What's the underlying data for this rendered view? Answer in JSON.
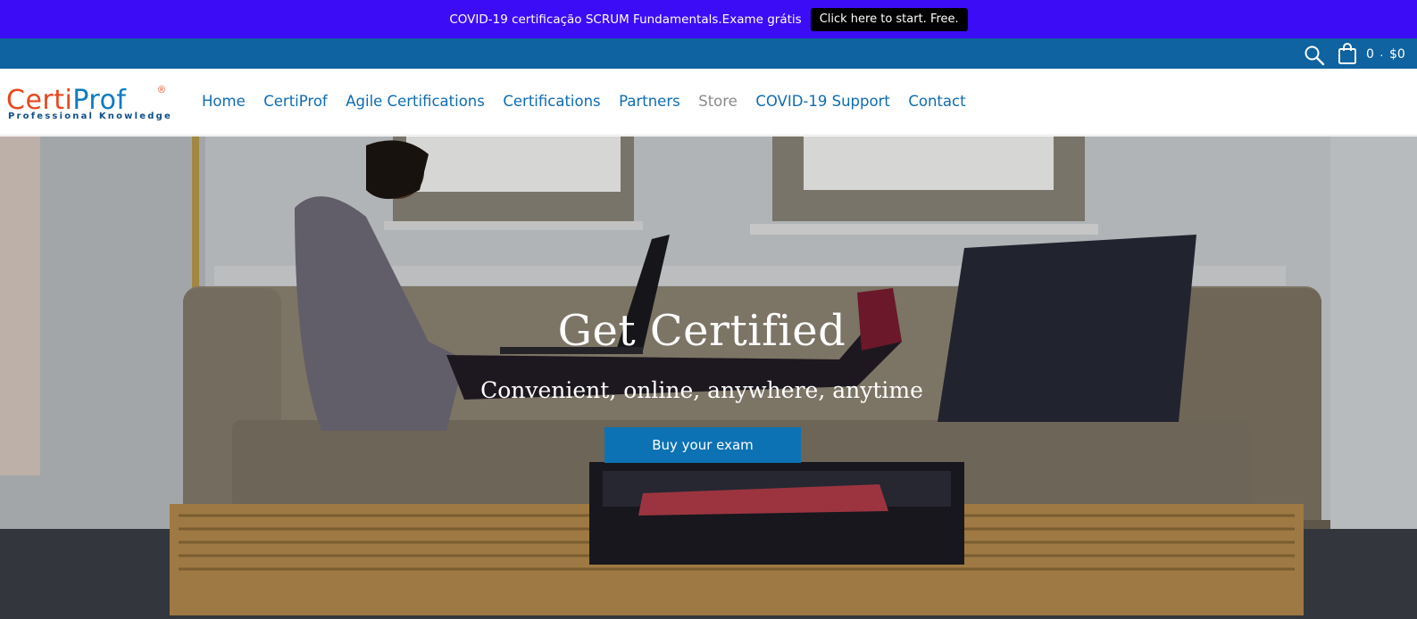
{
  "announcement": {
    "text": "COVID-19 certificação SCRUM Fundamentals.Exame grátis",
    "button_label": "Click here to start. Free."
  },
  "utility_bar": {
    "cart_count": "0",
    "cart_separator": "·",
    "cart_total": "$0"
  },
  "logo": {
    "part1": "Certi",
    "part2": "Prof",
    "registered": "®",
    "tagline": "Professional Knowledge"
  },
  "nav": {
    "items": [
      {
        "label": "Home"
      },
      {
        "label": "CertiProf"
      },
      {
        "label": "Agile Certifications"
      },
      {
        "label": "Certifications"
      },
      {
        "label": "Partners"
      },
      {
        "label": "Store"
      },
      {
        "label": "COVID-19 Support"
      },
      {
        "label": "Contact"
      }
    ]
  },
  "hero": {
    "title": "Get Certified",
    "subtitle": "Convenient, online, anywhere, anytime",
    "button_label": "Buy your exam"
  },
  "colors": {
    "announcement_bg": "#3c0cf7",
    "utility_bg": "#0e63a0",
    "nav_link": "#0e6cb3",
    "nav_active": "#8a8a8a",
    "logo_orange": "#e8471f",
    "logo_blue": "#0d7bbf",
    "hero_button": "#0d72b3"
  },
  "icons": [
    "search-icon",
    "cart-icon"
  ]
}
